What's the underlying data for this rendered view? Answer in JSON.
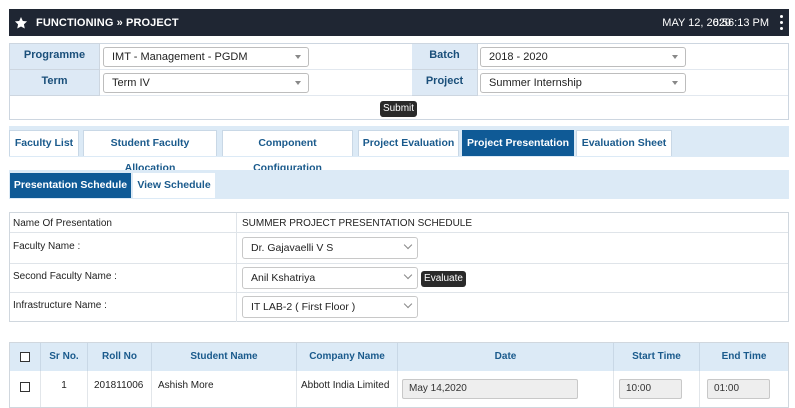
{
  "header": {
    "title": "FUNCTIONING » PROJECT",
    "date": "MAY 12, 2020",
    "time": "6:56:13 PM"
  },
  "filters": {
    "programme_label": "Programme",
    "programme_value": "IMT - Management - PGDM",
    "batch_label": "Batch",
    "batch_value": "2018 - 2020",
    "term_label": "Term",
    "term_value": "Term IV",
    "project_label": "Project",
    "project_value": "Summer Internship",
    "submit_label": "Submit"
  },
  "main_tabs": [
    {
      "label": "Faculty List"
    },
    {
      "label": "Student Faculty Allocation"
    },
    {
      "label": "Component Configuration"
    },
    {
      "label": "Project Evaluation"
    },
    {
      "label": "Project Presentation"
    },
    {
      "label": "Evaluation Sheet"
    }
  ],
  "sub_tabs": [
    {
      "label": "Presentation Schedule"
    },
    {
      "label": "View Schedule"
    }
  ],
  "form": {
    "presentation_label": "Name Of Presentation",
    "presentation_value": "SUMMER PROJECT PRESENTATION SCHEDULE",
    "faculty_label": "Faculty Name :",
    "faculty_value": "Dr. Gajavaelli V S",
    "second_faculty_label": "Second Faculty Name :",
    "second_faculty_value": "Anil Kshatriya",
    "evaluate_label": "Evaluate",
    "infrastructure_label": "Infrastructure Name :",
    "infrastructure_value": "IT LAB-2 ( First Floor )"
  },
  "table": {
    "headers": [
      "Sr No.",
      "Roll No",
      "Student Name",
      "Company Name",
      "Date",
      "Start Time",
      "End Time"
    ],
    "rows": [
      {
        "sr": "1",
        "roll": "201811006",
        "student": "Ashish More",
        "company": "Abbott India Limited",
        "date": "May 14,2020",
        "start": "10:00",
        "end": "01:00"
      }
    ]
  },
  "colors": {
    "header_bg": "#1f2633",
    "active_tab": "#0f5a96",
    "tab_strip": "#dceaf6",
    "label_text": "#1a5a8c"
  }
}
